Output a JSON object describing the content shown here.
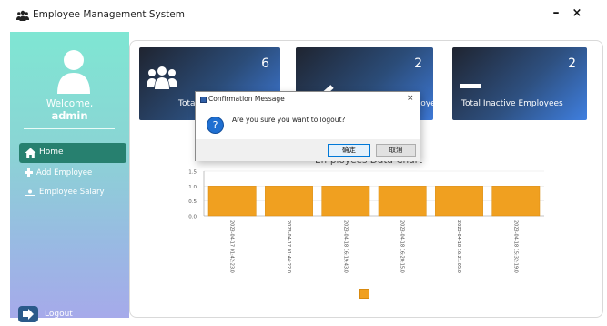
{
  "window": {
    "title": "Employee Management System",
    "minimize_glyph": "–",
    "close_glyph": "×",
    "icon": "users-icon"
  },
  "sidebar": {
    "welcome": "Welcome,",
    "username": "admin",
    "items": [
      {
        "label": "Home",
        "icon": "home-icon",
        "active": true
      },
      {
        "label": "Add Employee",
        "icon": "plus-icon",
        "active": false
      },
      {
        "label": "Employee Salary",
        "icon": "salary-icon",
        "active": false
      }
    ],
    "logout": "Logout",
    "colors": {
      "top": "#7fe6d3",
      "bottom": "#a6aaea",
      "active": "#27806f"
    }
  },
  "cards": [
    {
      "count": "6",
      "label": "Total Employees",
      "icon": "users-icon"
    },
    {
      "count": "2",
      "label": "Total Active Employees",
      "icon": "check-icon"
    },
    {
      "count": "2",
      "label": "Total Inactive Employees",
      "icon": "minus-icon"
    }
  ],
  "dialog": {
    "title": "Confirmation Message",
    "message": "Are you sure you want to logout?",
    "ok": "确定",
    "cancel": "取消",
    "close_glyph": "×",
    "icon": "question-icon"
  },
  "chart_data": {
    "type": "bar",
    "title": "Employees Data Chart",
    "categories": [
      "2023-04-17 01:42:23.0",
      "2023-04-17 01:44:22.0",
      "2023-04-18 16:19:43.0",
      "2023-04-18 16:20:15.0",
      "2023-04-18 16:21:05.0",
      "2023-04-18 15:32:19.0"
    ],
    "values": [
      1,
      1,
      1,
      1,
      1,
      1
    ],
    "y_ticks": [
      "0.0",
      "0.5",
      "1.0",
      "1.5"
    ],
    "ylim": [
      0,
      1.5
    ],
    "grid": true,
    "legend": "bottom",
    "bar_color": "#f0a020"
  }
}
